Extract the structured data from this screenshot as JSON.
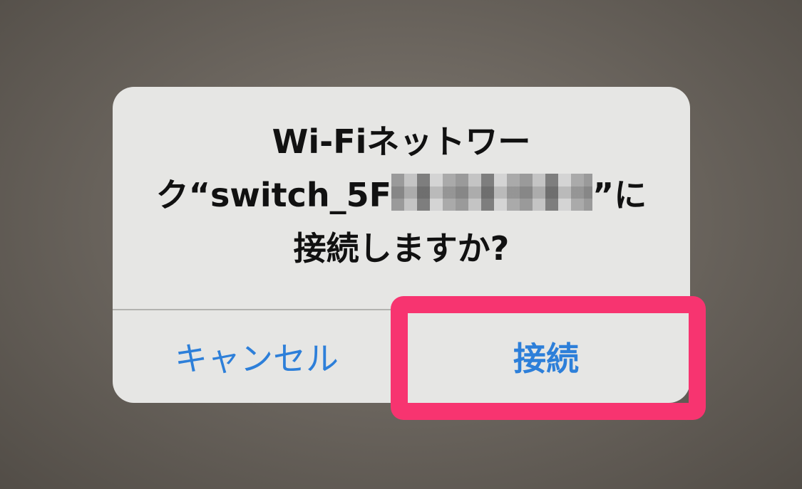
{
  "dialog": {
    "message_line1": "Wi-Fiネットワー",
    "message_line2_prefix": "ク“switch_5F",
    "message_line2_suffix": "”に",
    "message_line3": "接続しますか?"
  },
  "buttons": {
    "cancel_label": "キャンセル",
    "connect_label": "接続"
  },
  "colors": {
    "dialog_background": "#e6e6e4",
    "button_text": "#2d7fd9",
    "highlight_border": "#f73470",
    "message_text": "#111111"
  }
}
